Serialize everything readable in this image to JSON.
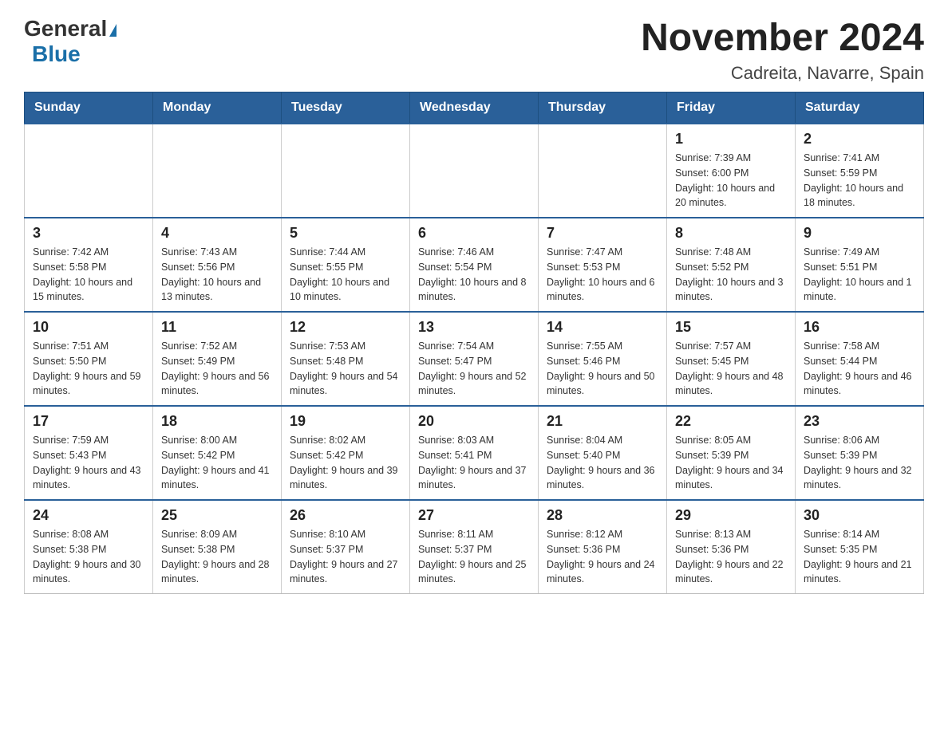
{
  "header": {
    "logo": {
      "general": "General",
      "triangle": "▶",
      "blue": "Blue"
    },
    "title": "November 2024",
    "subtitle": "Cadreita, Navarre, Spain"
  },
  "weekdays": [
    "Sunday",
    "Monday",
    "Tuesday",
    "Wednesday",
    "Thursday",
    "Friday",
    "Saturday"
  ],
  "weeks": [
    [
      {
        "day": "",
        "info": ""
      },
      {
        "day": "",
        "info": ""
      },
      {
        "day": "",
        "info": ""
      },
      {
        "day": "",
        "info": ""
      },
      {
        "day": "",
        "info": ""
      },
      {
        "day": "1",
        "info": "Sunrise: 7:39 AM\nSunset: 6:00 PM\nDaylight: 10 hours and 20 minutes."
      },
      {
        "day": "2",
        "info": "Sunrise: 7:41 AM\nSunset: 5:59 PM\nDaylight: 10 hours and 18 minutes."
      }
    ],
    [
      {
        "day": "3",
        "info": "Sunrise: 7:42 AM\nSunset: 5:58 PM\nDaylight: 10 hours and 15 minutes."
      },
      {
        "day": "4",
        "info": "Sunrise: 7:43 AM\nSunset: 5:56 PM\nDaylight: 10 hours and 13 minutes."
      },
      {
        "day": "5",
        "info": "Sunrise: 7:44 AM\nSunset: 5:55 PM\nDaylight: 10 hours and 10 minutes."
      },
      {
        "day": "6",
        "info": "Sunrise: 7:46 AM\nSunset: 5:54 PM\nDaylight: 10 hours and 8 minutes."
      },
      {
        "day": "7",
        "info": "Sunrise: 7:47 AM\nSunset: 5:53 PM\nDaylight: 10 hours and 6 minutes."
      },
      {
        "day": "8",
        "info": "Sunrise: 7:48 AM\nSunset: 5:52 PM\nDaylight: 10 hours and 3 minutes."
      },
      {
        "day": "9",
        "info": "Sunrise: 7:49 AM\nSunset: 5:51 PM\nDaylight: 10 hours and 1 minute."
      }
    ],
    [
      {
        "day": "10",
        "info": "Sunrise: 7:51 AM\nSunset: 5:50 PM\nDaylight: 9 hours and 59 minutes."
      },
      {
        "day": "11",
        "info": "Sunrise: 7:52 AM\nSunset: 5:49 PM\nDaylight: 9 hours and 56 minutes."
      },
      {
        "day": "12",
        "info": "Sunrise: 7:53 AM\nSunset: 5:48 PM\nDaylight: 9 hours and 54 minutes."
      },
      {
        "day": "13",
        "info": "Sunrise: 7:54 AM\nSunset: 5:47 PM\nDaylight: 9 hours and 52 minutes."
      },
      {
        "day": "14",
        "info": "Sunrise: 7:55 AM\nSunset: 5:46 PM\nDaylight: 9 hours and 50 minutes."
      },
      {
        "day": "15",
        "info": "Sunrise: 7:57 AM\nSunset: 5:45 PM\nDaylight: 9 hours and 48 minutes."
      },
      {
        "day": "16",
        "info": "Sunrise: 7:58 AM\nSunset: 5:44 PM\nDaylight: 9 hours and 46 minutes."
      }
    ],
    [
      {
        "day": "17",
        "info": "Sunrise: 7:59 AM\nSunset: 5:43 PM\nDaylight: 9 hours and 43 minutes."
      },
      {
        "day": "18",
        "info": "Sunrise: 8:00 AM\nSunset: 5:42 PM\nDaylight: 9 hours and 41 minutes."
      },
      {
        "day": "19",
        "info": "Sunrise: 8:02 AM\nSunset: 5:42 PM\nDaylight: 9 hours and 39 minutes."
      },
      {
        "day": "20",
        "info": "Sunrise: 8:03 AM\nSunset: 5:41 PM\nDaylight: 9 hours and 37 minutes."
      },
      {
        "day": "21",
        "info": "Sunrise: 8:04 AM\nSunset: 5:40 PM\nDaylight: 9 hours and 36 minutes."
      },
      {
        "day": "22",
        "info": "Sunrise: 8:05 AM\nSunset: 5:39 PM\nDaylight: 9 hours and 34 minutes."
      },
      {
        "day": "23",
        "info": "Sunrise: 8:06 AM\nSunset: 5:39 PM\nDaylight: 9 hours and 32 minutes."
      }
    ],
    [
      {
        "day": "24",
        "info": "Sunrise: 8:08 AM\nSunset: 5:38 PM\nDaylight: 9 hours and 30 minutes."
      },
      {
        "day": "25",
        "info": "Sunrise: 8:09 AM\nSunset: 5:38 PM\nDaylight: 9 hours and 28 minutes."
      },
      {
        "day": "26",
        "info": "Sunrise: 8:10 AM\nSunset: 5:37 PM\nDaylight: 9 hours and 27 minutes."
      },
      {
        "day": "27",
        "info": "Sunrise: 8:11 AM\nSunset: 5:37 PM\nDaylight: 9 hours and 25 minutes."
      },
      {
        "day": "28",
        "info": "Sunrise: 8:12 AM\nSunset: 5:36 PM\nDaylight: 9 hours and 24 minutes."
      },
      {
        "day": "29",
        "info": "Sunrise: 8:13 AM\nSunset: 5:36 PM\nDaylight: 9 hours and 22 minutes."
      },
      {
        "day": "30",
        "info": "Sunrise: 8:14 AM\nSunset: 5:35 PM\nDaylight: 9 hours and 21 minutes."
      }
    ]
  ]
}
